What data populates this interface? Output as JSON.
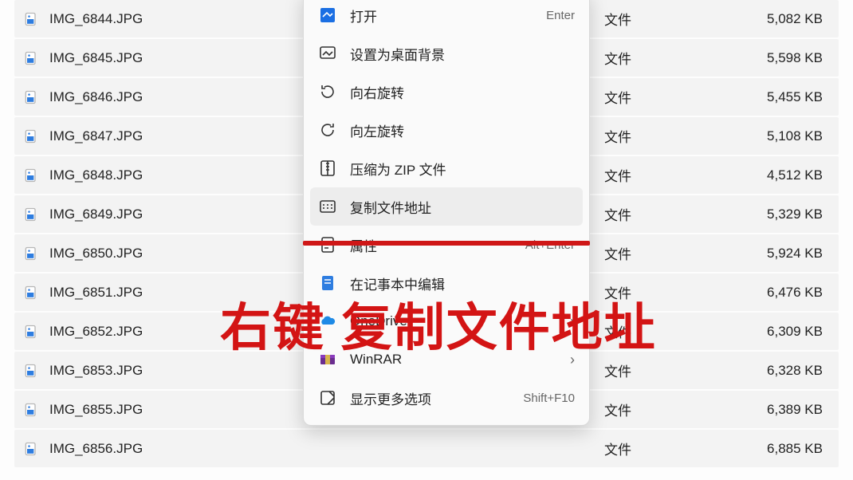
{
  "files": [
    {
      "name": "IMG_6844.JPG",
      "type": "文件",
      "size": "5,082 KB"
    },
    {
      "name": "IMG_6845.JPG",
      "type": "文件",
      "size": "5,598 KB"
    },
    {
      "name": "IMG_6846.JPG",
      "type": "文件",
      "size": "5,455 KB"
    },
    {
      "name": "IMG_6847.JPG",
      "type": "文件",
      "size": "5,108 KB"
    },
    {
      "name": "IMG_6848.JPG",
      "type": "文件",
      "size": "4,512 KB"
    },
    {
      "name": "IMG_6849.JPG",
      "type": "文件",
      "size": "5,329 KB"
    },
    {
      "name": "IMG_6850.JPG",
      "type": "文件",
      "size": "5,924 KB"
    },
    {
      "name": "IMG_6851.JPG",
      "type": "文件",
      "size": "6,476 KB"
    },
    {
      "name": "IMG_6852.JPG",
      "type": "文件",
      "size": "6,309 KB"
    },
    {
      "name": "IMG_6853.JPG",
      "type": "文件",
      "size": "6,328 KB"
    },
    {
      "name": "IMG_6855.JPG",
      "type": "文件",
      "size": "6,389 KB"
    },
    {
      "name": "IMG_6856.JPG",
      "type": "文件",
      "size": "6,885 KB"
    }
  ],
  "menu": {
    "open": {
      "label": "打开",
      "shortcut": "Enter"
    },
    "set_wallpaper": {
      "label": "设置为桌面背景",
      "shortcut": ""
    },
    "rotate_right": {
      "label": "向右旋转",
      "shortcut": ""
    },
    "rotate_left": {
      "label": "向左旋转",
      "shortcut": ""
    },
    "compress_zip": {
      "label": "压缩为 ZIP 文件",
      "shortcut": ""
    },
    "copy_path": {
      "label": "复制文件地址",
      "shortcut": ""
    },
    "properties": {
      "label": "属性",
      "shortcut": "Alt+Enter"
    },
    "edit_in": {
      "label": "在记事本中编辑",
      "shortcut": ""
    },
    "onedrive": {
      "label": "OneDrive",
      "shortcut": "",
      "has_sub": true
    },
    "winrar": {
      "label": "WinRAR",
      "shortcut": "",
      "has_sub": true
    },
    "show_more": {
      "label": "显示更多选项",
      "shortcut": "Shift+F10"
    }
  },
  "annotation_text": "右键 复制文件地址"
}
